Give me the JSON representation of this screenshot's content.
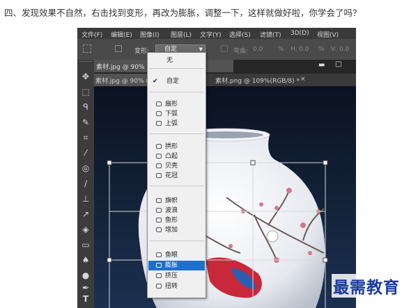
{
  "caption": "四、发现效果不自然，右击找到变形，再改为膨胀，调整一下，这样就做好啦，你学会了吗？",
  "menubar": {
    "items": [
      "文件(F)",
      "编辑(E)",
      "图像(I)",
      "图层(L)",
      "文字(Y)",
      "选择(S)",
      "滤镜(T)",
      "3D(D)",
      "视图(V)"
    ]
  },
  "options_bar": {
    "warp_label": "变形:",
    "warp_value": "自定",
    "bend_label": "弯曲:",
    "bend_value": "0.0",
    "percent": "%",
    "h_label": "H:",
    "h_value": "0.0",
    "v_label": "V:",
    "v_value": "0.0"
  },
  "floating_window_title": "素材.jpg @ 90%",
  "tabs": [
    {
      "label": "素材.jpg @ 90% (",
      "active": true
    },
    {
      "label": "素材.png @ 109%(RGB/8) *",
      "active": false
    }
  ],
  "tab_close": "×",
  "window_controls": {
    "minimize": "▬",
    "restore": "□"
  },
  "warp_menu": {
    "items": [
      {
        "label": "无",
        "icon": "none-icon",
        "checked": false,
        "highlighted": false
      },
      {
        "label": "自定",
        "icon": "none-icon",
        "checked": true,
        "highlighted": false
      },
      {
        "label": "扇形",
        "icon": "arc-icon",
        "checked": false,
        "highlighted": false
      },
      {
        "label": "下弧",
        "icon": "arc-lower-icon",
        "checked": false,
        "highlighted": false
      },
      {
        "label": "上弧",
        "icon": "arc-upper-icon",
        "checked": false,
        "highlighted": false
      },
      {
        "label": "拱形",
        "icon": "arch-icon",
        "checked": false,
        "highlighted": false
      },
      {
        "label": "凸起",
        "icon": "bulge-icon",
        "checked": false,
        "highlighted": false
      },
      {
        "label": "贝壳",
        "icon": "shell-icon",
        "checked": false,
        "highlighted": false
      },
      {
        "label": "花冠",
        "icon": "flower-icon",
        "checked": false,
        "highlighted": false
      },
      {
        "label": "旗帜",
        "icon": "flag-icon",
        "checked": false,
        "highlighted": false
      },
      {
        "label": "波浪",
        "icon": "wave-icon",
        "checked": false,
        "highlighted": false
      },
      {
        "label": "鱼形",
        "icon": "fish-icon",
        "checked": false,
        "highlighted": false
      },
      {
        "label": "增加",
        "icon": "rise-icon",
        "checked": false,
        "highlighted": false
      },
      {
        "label": "鱼眼",
        "icon": "fisheye-icon",
        "checked": false,
        "highlighted": false
      },
      {
        "label": "膨胀",
        "icon": "inflate-icon",
        "checked": false,
        "highlighted": true
      },
      {
        "label": "挤压",
        "icon": "squeeze-icon",
        "checked": false,
        "highlighted": false
      },
      {
        "label": "扭转",
        "icon": "twist-icon",
        "checked": false,
        "highlighted": false
      }
    ]
  },
  "watermark": "最需教育",
  "colors": {
    "highlight": "#1e6fd0",
    "canvas_top": "#0b1220",
    "bird_red": "#c8283a",
    "bird_blue": "#2a5fb0"
  }
}
